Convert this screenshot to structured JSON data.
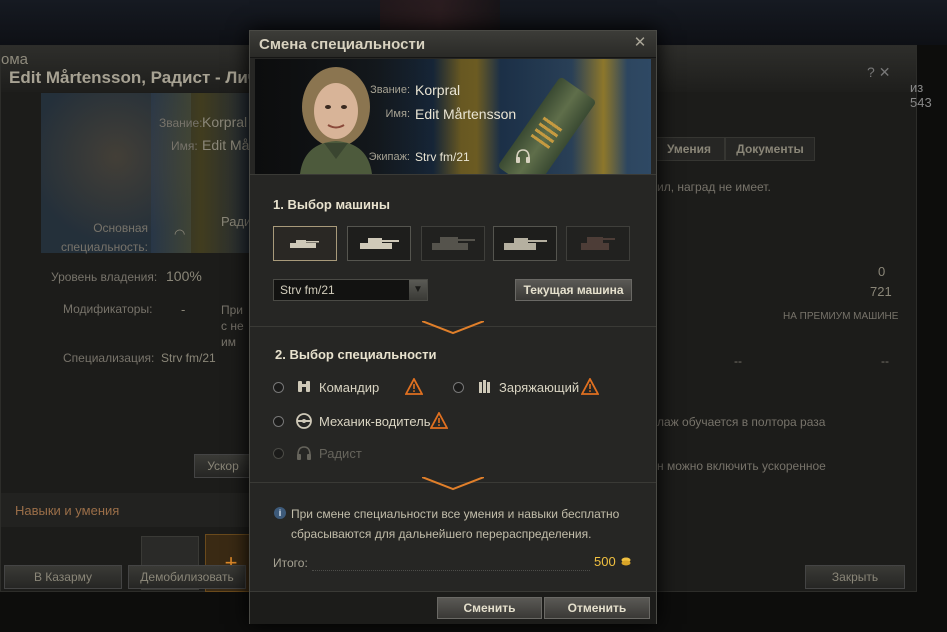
{
  "background": {
    "title_left": "ома",
    "title": "Edit Mårtensson, Радист - Личное",
    "right_count": "из 543",
    "tabs": [
      "Умения",
      "Документы"
    ],
    "rank_label": "Звание:",
    "rank_value": "Korpral",
    "name_label": "Имя:",
    "name_value": "Edit Mår",
    "primary_spec_label": "Основная специальность:",
    "primary_spec_value": "Ради",
    "mastery_label": "Уровень владения:",
    "mastery_value": "100%",
    "modifiers_label": "Модификаторы:",
    "modifiers_value": "-",
    "modifiers_note": "При с не им",
    "specialization_label": "Специализация:",
    "specialization_value": "Strv fm/21",
    "awards_note": "ил, наград не имеет.",
    "stat_1": "0",
    "stat_2": "721",
    "premium_vehicle": "НА ПРЕМИУМ МАШИНЕ",
    "dash_1": "--",
    "dash_2": "--",
    "note_1": "лаж обучается в полтора раза",
    "note_2": "н можно включить ускоренное",
    "skills_section": "Навыки и умения",
    "accelerate_btn": "Ускор",
    "plus": "+",
    "barracks_btn": "В Казарму",
    "demobilize_btn": "Демобилизовать",
    "close_btn": "Закрыть"
  },
  "dialog": {
    "title": "Смена специальности",
    "close_icon": "close-icon",
    "rank_label": "Звание:",
    "rank_value": "Korpral",
    "name_label": "Имя:",
    "name_value": "Edit Mårtensson",
    "crew_label": "Экипаж:",
    "crew_value": "Strv fm/21",
    "section1_title": "1. Выбор машины",
    "vehicles": [
      "light-tank",
      "medium-tank",
      "heavy-tank",
      "td-tank",
      "spg-tank"
    ],
    "vehicle_select_value": "Strv fm/21",
    "current_vehicle_btn": "Текущая машина",
    "section2_title": "2. Выбор специальности",
    "specs": {
      "commander": "Командир",
      "loader": "Заряжающий",
      "driver": "Механик-водитель",
      "radio": "Радист"
    },
    "info_text": "При смене специальности все умения и навыки бесплатно сбрасываются для дальнейшего перераспределения.",
    "total_label": "Итого:",
    "total_value": "500",
    "change_btn": "Сменить",
    "cancel_btn": "Отменить",
    "colors": {
      "accent": "#e07f2a",
      "gold": "#f0c040",
      "warning": "#e07020"
    }
  }
}
